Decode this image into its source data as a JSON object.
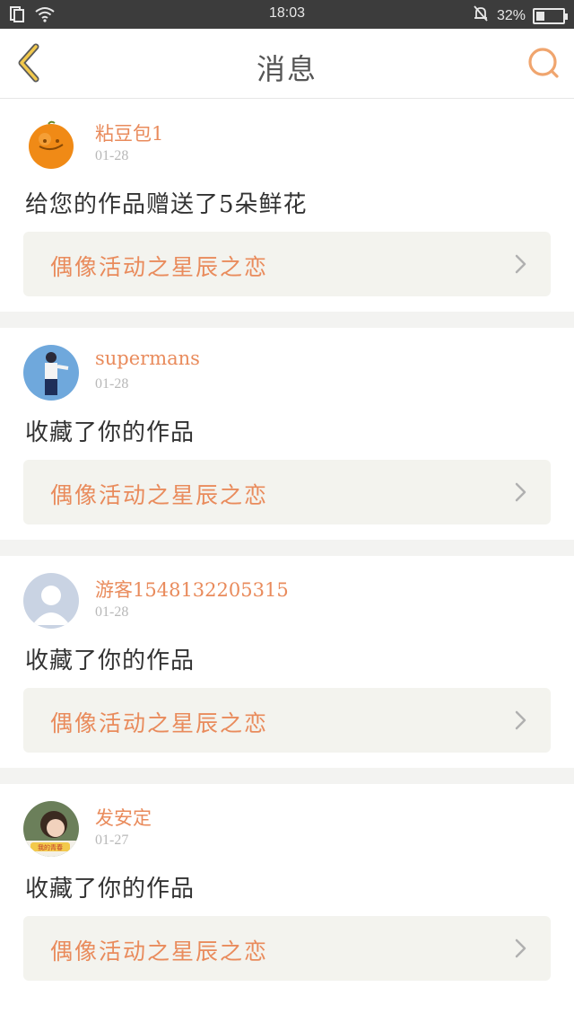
{
  "status_bar": {
    "time": "18:03",
    "battery_text": "32%",
    "battery_level": 0.32
  },
  "header": {
    "title": "消息"
  },
  "messages": [
    {
      "username": "粘豆包1",
      "date": "01-28",
      "action": "给您的作品赠送了5朵鲜花",
      "work_title": "偶像活动之星辰之恋",
      "avatar": "orange-avatar"
    },
    {
      "username": "supermans",
      "date": "01-28",
      "action": "收藏了你的作品",
      "work_title": "偶像活动之星辰之恋",
      "avatar": "person-avatar"
    },
    {
      "username": "游客1548132205315",
      "date": "01-28",
      "action": "收藏了你的作品",
      "work_title": "偶像活动之星辰之恋",
      "avatar": "default-avatar"
    },
    {
      "username": "发安定",
      "date": "01-27",
      "action": "收藏了你的作品",
      "work_title": "偶像活动之星辰之恋",
      "avatar": "photo-avatar",
      "avatar_caption": "我的青春"
    }
  ],
  "colors": {
    "accent": "#e98b5c",
    "back_arrow": "#f2c94c",
    "card_bg": "#f3f3ee",
    "separator": "#f3f3f1"
  }
}
